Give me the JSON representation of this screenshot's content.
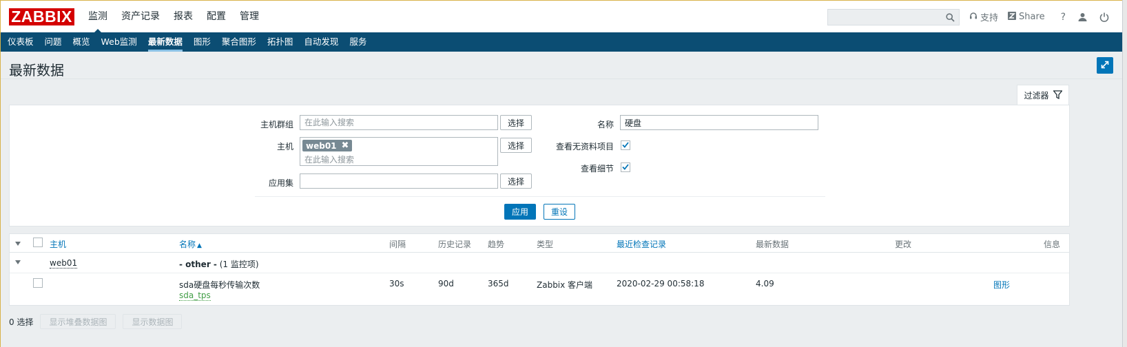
{
  "brand": {
    "logo_text": "ZABBIX",
    "logo_color": "#d40000"
  },
  "main_menu": [
    {
      "label": "监测",
      "active": true
    },
    {
      "label": "资产记录"
    },
    {
      "label": "报表"
    },
    {
      "label": "配置"
    },
    {
      "label": "管理"
    }
  ],
  "header_right": {
    "search_placeholder": "",
    "support_label": "支持",
    "share_label": "Share",
    "help_label": "?"
  },
  "sub_menu": [
    {
      "label": "仪表板"
    },
    {
      "label": "问题"
    },
    {
      "label": "概览"
    },
    {
      "label": "Web监测"
    },
    {
      "label": "最新数据",
      "active": true
    },
    {
      "label": "图形"
    },
    {
      "label": "聚合图形"
    },
    {
      "label": "拓扑图"
    },
    {
      "label": "自动发现"
    },
    {
      "label": "服务"
    }
  ],
  "page": {
    "title": "最新数据"
  },
  "filter": {
    "tab_label": "过滤器",
    "host_group_label": "主机群组",
    "host_group_placeholder": "在此输入搜索",
    "host_label": "主机",
    "host_tag": "web01",
    "host_placeholder": "在此输入搜索",
    "app_label": "应用集",
    "app_value": "",
    "select_label": "选择",
    "name_label": "名称",
    "name_value": "硬盘",
    "show_no_data_label": "查看无资料项目",
    "show_no_data_checked": true,
    "show_details_label": "查看细节",
    "show_details_checked": true,
    "apply_label": "应用",
    "reset_label": "重设"
  },
  "table": {
    "columns": {
      "host": "主机",
      "name": "名称",
      "name_sort": "▲",
      "interval": "间隔",
      "history": "历史记录",
      "trends": "趋势",
      "type": "类型",
      "last_check": "最近检查记录",
      "last_value": "最新数据",
      "change": "更改",
      "info": "信息"
    },
    "group": {
      "host": "web01",
      "app": "- other -",
      "count": "(1 监控项)"
    },
    "row": {
      "name": "sda硬盘每秒传输次数",
      "key": "sda_tps",
      "interval": "30s",
      "history": "90d",
      "trends": "365d",
      "type": "Zabbix 客户端",
      "last_check": "2020-02-29 00:58:18",
      "last_value": "4.09",
      "change": "",
      "action": "图形"
    }
  },
  "footer": {
    "selected": "0 选择",
    "stacked_graph_label": "显示堆叠数据图",
    "graph_label": "显示数据图"
  },
  "colors": {
    "nav": "#0b4d73",
    "accent": "#0275b8",
    "link_green": "#429e47"
  }
}
